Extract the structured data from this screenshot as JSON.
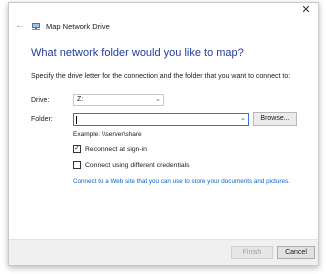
{
  "window": {
    "title": "Map Network Drive",
    "close_glyph": "✕",
    "back_glyph": "←",
    "app_icon": "network-drive-icon"
  },
  "heading": "What network folder would you like to map?",
  "instruction": "Specify the drive letter for the connection and the folder that you want to connect to:",
  "drive": {
    "label": "Drive:",
    "value": "Z:"
  },
  "folder": {
    "label": "Folder:",
    "value": "",
    "browse_label": "Browse..."
  },
  "example": "Example: \\\\server\\share",
  "options": {
    "reconnect": {
      "label": "Reconnect at sign-in",
      "checked": true
    },
    "different_credentials": {
      "label": "Connect using different credentials",
      "checked": false
    }
  },
  "link": "Connect to a Web site that you can use to store your documents and pictures.",
  "buttons": {
    "finish": "Finish",
    "cancel": "Cancel"
  },
  "colors": {
    "heading": "#1f3d99",
    "link": "#0b63c9",
    "focus_border": "#3a6fd8"
  }
}
